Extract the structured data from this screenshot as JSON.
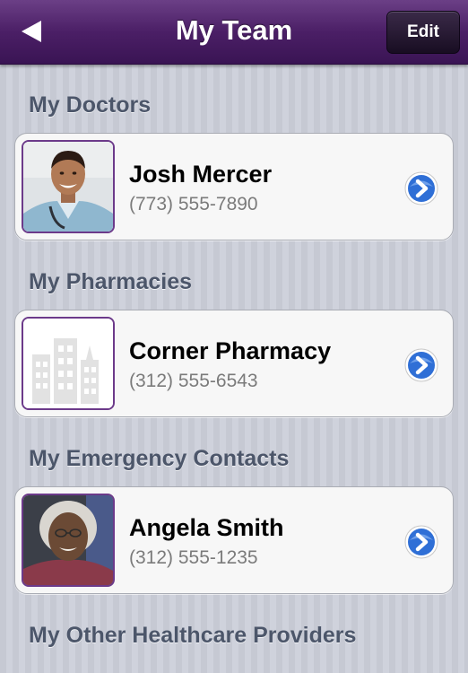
{
  "navbar": {
    "title": "My Team",
    "back_icon": "back-arrow-icon",
    "edit_label": "Edit"
  },
  "sections": [
    {
      "header": "My Doctors",
      "contact": {
        "name": "Josh Mercer",
        "phone": "(773) 555-7890",
        "thumbnail": "doctor-photo",
        "action_icon": "chevron-right-circle-icon"
      }
    },
    {
      "header": "My Pharmacies",
      "contact": {
        "name": "Corner Pharmacy",
        "phone": "(312) 555-6543",
        "thumbnail": "building-placeholder-icon",
        "action_icon": "chevron-right-circle-icon"
      }
    },
    {
      "header": "My Emergency Contacts",
      "contact": {
        "name": "Angela Smith",
        "phone": "(312) 555-1235",
        "thumbnail": "contact-photo",
        "action_icon": "chevron-right-circle-icon"
      }
    },
    {
      "header": "My Other Healthcare Providers"
    }
  ],
  "colors": {
    "navbar": "#4b1f66",
    "accent_border": "#6c3a8a",
    "section_header_text": "#4c566a",
    "disclosure_blue": "#2f6fd6"
  }
}
